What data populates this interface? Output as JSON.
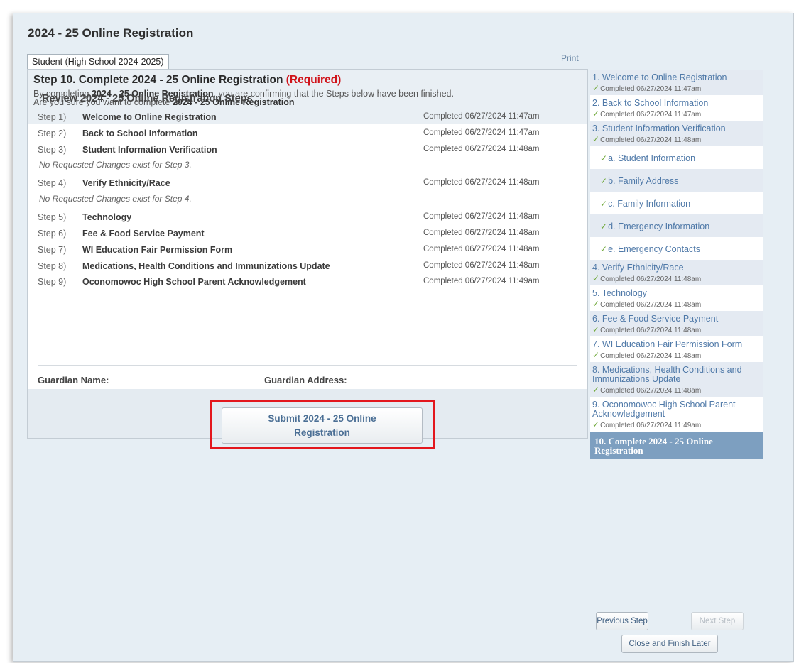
{
  "app_title": "2024 - 25 Online Registration",
  "tab_label": "Student (High School 2024-2025)",
  "print_label": "Print",
  "main": {
    "step_label": "Step 10. Complete 2024 - 25 Online Registration",
    "required_label": "(Required)",
    "confirm_part1": "By completing ",
    "confirm_bold1": "2024 - 25 Online Registration",
    "confirm_part2": ", you are confirming that the Steps below have been finished.",
    "confirm_part3": "Are you sure you want to complete ",
    "confirm_bold2": "2024 - 25 Online Registration",
    "review_title": "Review 2024 - 25 Online Registration Steps",
    "steps": [
      {
        "num": "Step 1)",
        "name": "Welcome to Online Registration",
        "status": "Completed 06/27/2024 11:47am"
      },
      {
        "num": "Step 2)",
        "name": "Back to School Information",
        "status": "Completed 06/27/2024 11:47am"
      },
      {
        "num": "Step 3)",
        "name": "Student Information Verification",
        "status": "Completed 06/27/2024 11:48am"
      },
      {
        "num": "Step 4)",
        "name": "Verify Ethnicity/Race",
        "status": "Completed 06/27/2024 11:48am"
      },
      {
        "num": "Step 5)",
        "name": "Technology",
        "status": "Completed 06/27/2024 11:48am"
      },
      {
        "num": "Step 6)",
        "name": "Fee & Food Service Payment",
        "status": "Completed 06/27/2024 11:48am"
      },
      {
        "num": "Step 7)",
        "name": "WI Education Fair Permission Form",
        "status": "Completed 06/27/2024 11:48am"
      },
      {
        "num": "Step 8)",
        "name": "Medications, Health Conditions and Immunizations Update",
        "status": "Completed 06/27/2024 11:48am"
      },
      {
        "num": "Step 9)",
        "name": "Oconomowoc High School Parent Acknowledgement",
        "status": "Completed 06/27/2024 11:49am"
      }
    ],
    "note_step3": "No Requested Changes exist for Step 3.",
    "note_step4": "No Requested Changes exist for Step 4.",
    "guardian_name_label": "Guardian Name:",
    "guardian_address_label": "Guardian Address:",
    "submit_line1": "Submit 2024 - 25 Online",
    "submit_line2": "Registration"
  },
  "sidebar": {
    "items": [
      {
        "label": "1. Welcome to Online Registration",
        "status": "Completed 06/27/2024 11:47am"
      },
      {
        "label": "2. Back to School Information",
        "status": "Completed 06/27/2024 11:47am"
      },
      {
        "label": "3. Student Information Verification",
        "status": "Completed 06/27/2024 11:48am"
      },
      {
        "label": "a. Student Information"
      },
      {
        "label": "b. Family Address"
      },
      {
        "label": "c. Family Information"
      },
      {
        "label": "d. Emergency Information"
      },
      {
        "label": "e. Emergency Contacts"
      },
      {
        "label": "4. Verify Ethnicity/Race",
        "status": "Completed 06/27/2024 11:48am"
      },
      {
        "label": "5. Technology",
        "status": "Completed 06/27/2024 11:48am"
      },
      {
        "label": "6. Fee & Food Service Payment",
        "status": "Completed 06/27/2024 11:48am"
      },
      {
        "label": "7. WI Education Fair Permission Form",
        "status": "Completed 06/27/2024 11:48am"
      },
      {
        "label": "8. Medications, Health Conditions and Immunizations Update",
        "status": "Completed 06/27/2024 11:48am"
      },
      {
        "label": "9. Oconomowoc High School Parent Acknowledgement",
        "status": "Completed 06/27/2024 11:49am"
      },
      {
        "label": "10. Complete 2024 - 25 Online Registration"
      }
    ]
  },
  "buttons": {
    "previous": "Previous Step",
    "next": "Next Step",
    "close": "Close and Finish Later"
  },
  "colors": {
    "required": "#d0141b",
    "link": "#4f79a8",
    "active_step": "#7d9fc0",
    "check": "#6fa83a",
    "highlight_box": "#e3171d"
  }
}
